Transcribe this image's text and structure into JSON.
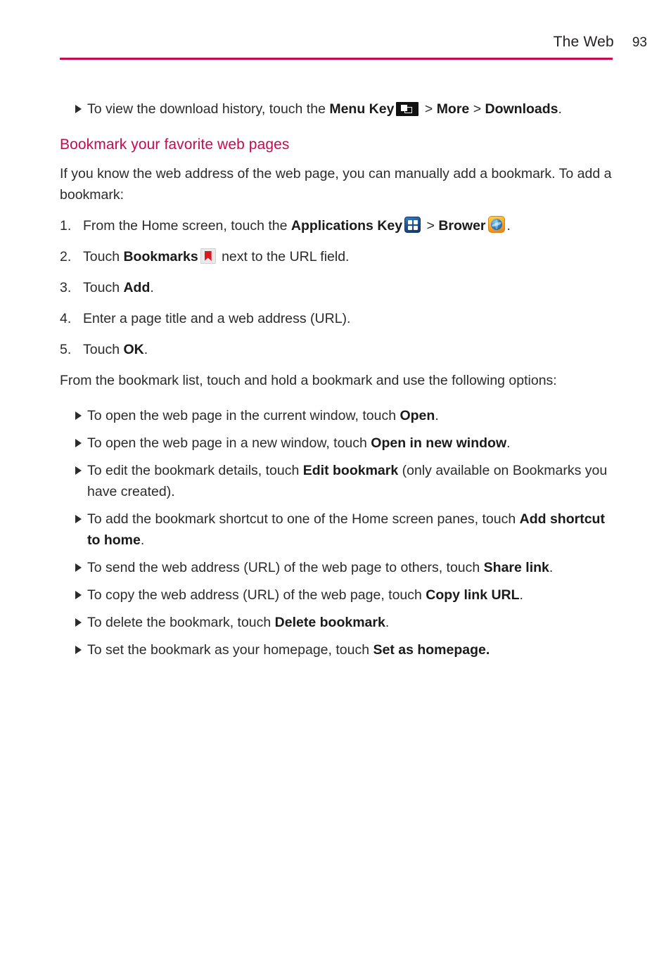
{
  "header": {
    "title": "The Web",
    "page_number": "93",
    "rule_color": "#c80a50"
  },
  "colors": {
    "accent": "#c80a50",
    "body_text": "#2b2b2b",
    "bold_text": "#1a1a1a"
  },
  "intro_bullet": {
    "marker": "triangle-bullet",
    "part1": "To view the download history, touch the ",
    "bold1": "Menu Key",
    "icon1": "menu-key-icon",
    "part2": " > ",
    "bold2": "More",
    "part3": " > ",
    "bold3": "Downloads",
    "part4": "."
  },
  "section": {
    "heading": "Bookmark your favorite web pages",
    "intro": "If you know the web address of the web page, you can manually add a bookmark. To add a bookmark:"
  },
  "steps": [
    {
      "num": "1.",
      "part1": "From the Home screen, touch the ",
      "bold1": "Applications Key",
      "icon1": "applications-key-icon",
      "part2": " > ",
      "bold2": "Brower",
      "icon2": "browser-icon",
      "part3": "."
    },
    {
      "num": "2.",
      "part1": "Touch ",
      "bold1": "Bookmarks",
      "icon1": "bookmarks-icon",
      "part2": " next to the URL field.",
      "bold2": "",
      "part3": ""
    },
    {
      "num": "3.",
      "part1": "Touch ",
      "bold1": "Add",
      "part2": ".",
      "bold2": "",
      "part3": ""
    },
    {
      "num": "4.",
      "part1": "Enter a page title and a web address (URL).",
      "bold1": "",
      "part2": "",
      "bold2": "",
      "part3": ""
    },
    {
      "num": "5.",
      "part1": "Touch ",
      "bold1": "OK",
      "part2": ".",
      "bold2": "",
      "part3": ""
    }
  ],
  "options_intro": "From the bookmark list, touch and hold a bookmark and use the following options:",
  "options": [
    {
      "part1": "To open the web page in the current window, touch ",
      "bold1": "Open",
      "part2": "."
    },
    {
      "part1": "To open the web page in a new window, touch ",
      "bold1": "Open in new window",
      "part2": "."
    },
    {
      "part1": "To edit the bookmark details, touch ",
      "bold1": "Edit bookmark",
      "part2": " (only available on Bookmarks you have created)."
    },
    {
      "part1": "To add the bookmark shortcut to one of the Home screen panes, touch ",
      "bold1": "Add shortcut to home",
      "part2": "."
    },
    {
      "part1": "To send the web address (URL) of the web page to others, touch ",
      "bold1": "Share link",
      "part2": "."
    },
    {
      "part1": "To copy the web address (URL) of the web page, touch ",
      "bold1": "Copy link URL",
      "part2": "."
    },
    {
      "part1": "To delete the bookmark, touch ",
      "bold1": "Delete bookmark",
      "part2": "."
    },
    {
      "part1": "To set the bookmark as your homepage, touch ",
      "bold1": "Set as homepage.",
      "part2": ""
    }
  ]
}
